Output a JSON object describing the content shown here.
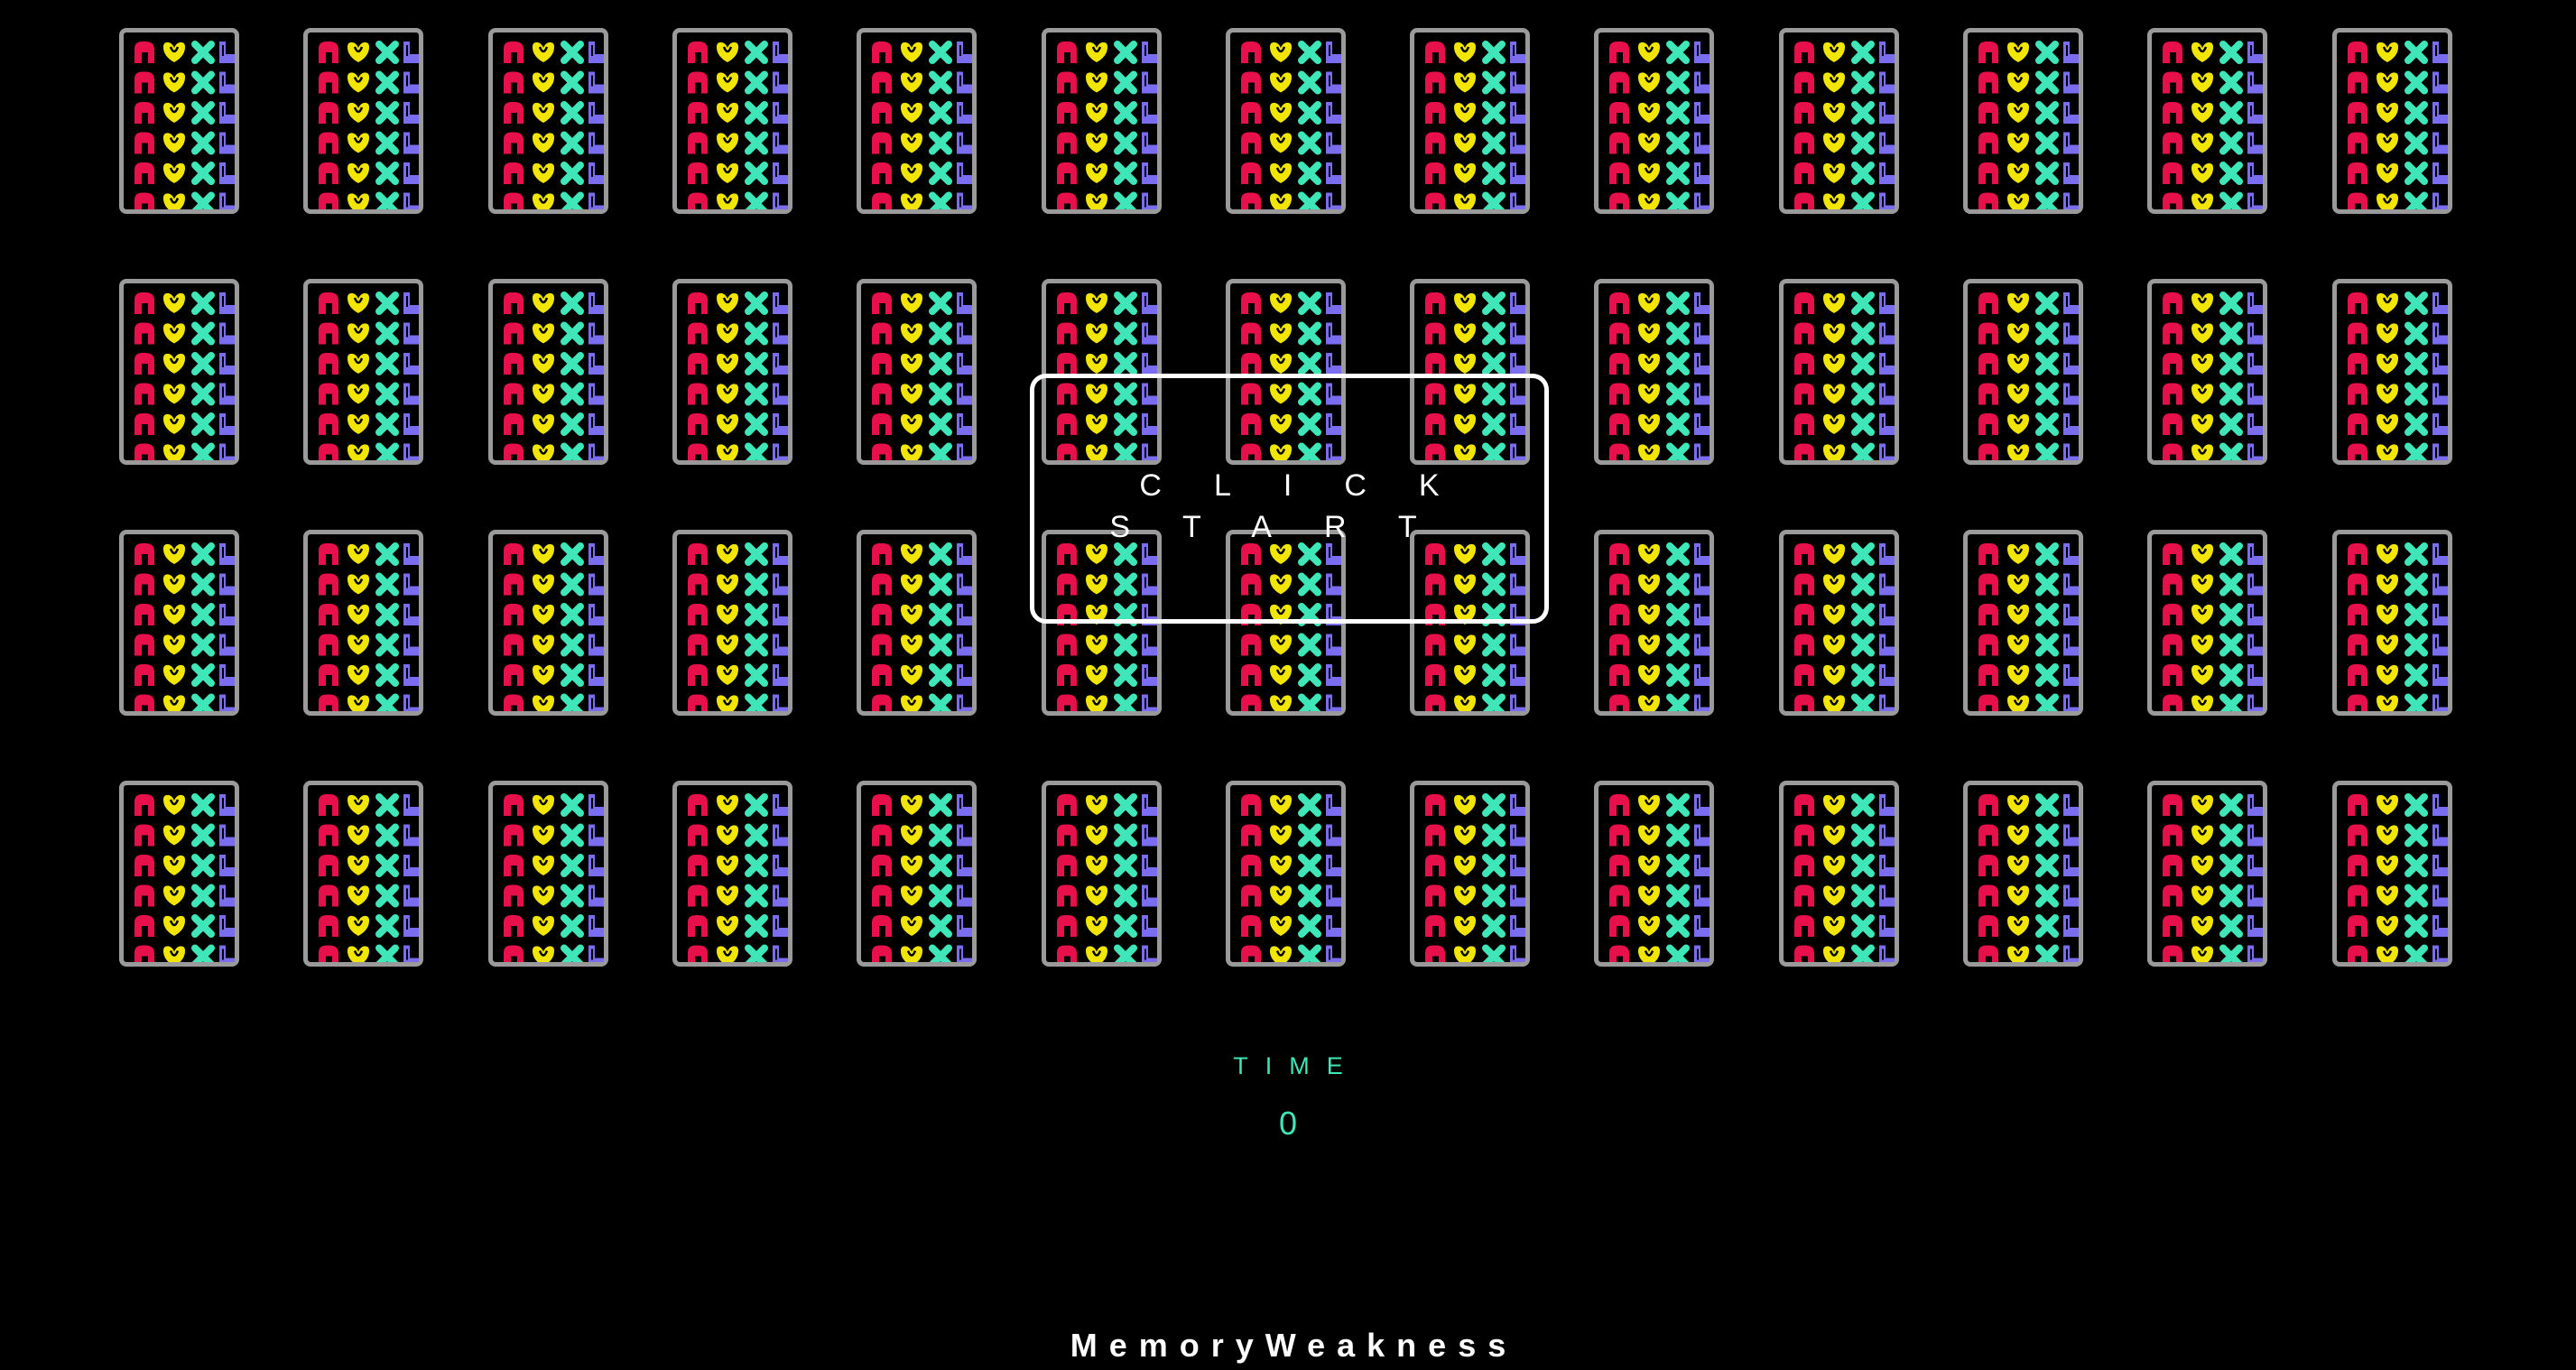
{
  "game": {
    "title": "MemoryWeakness",
    "start_button_label": "CLICK\nSTART",
    "time_label": "TIME",
    "time_value": "0"
  },
  "board": {
    "rows": 4,
    "columns": 13,
    "card_state": "face-down",
    "card_back_pattern": {
      "columns": [
        "red-arch-icon",
        "yellow-heart-icon",
        "teal-cross-icon",
        "purple-boot-icon"
      ],
      "rows": 6
    }
  },
  "colors": {
    "background": "#000000",
    "card_border": "#9a9a9a",
    "arch": "#e8104a",
    "heart": "#f2e600",
    "cross": "#3ee6b8",
    "boot": "#7a6df0",
    "accent": "#3ee6b8",
    "text": "#ffffff"
  }
}
